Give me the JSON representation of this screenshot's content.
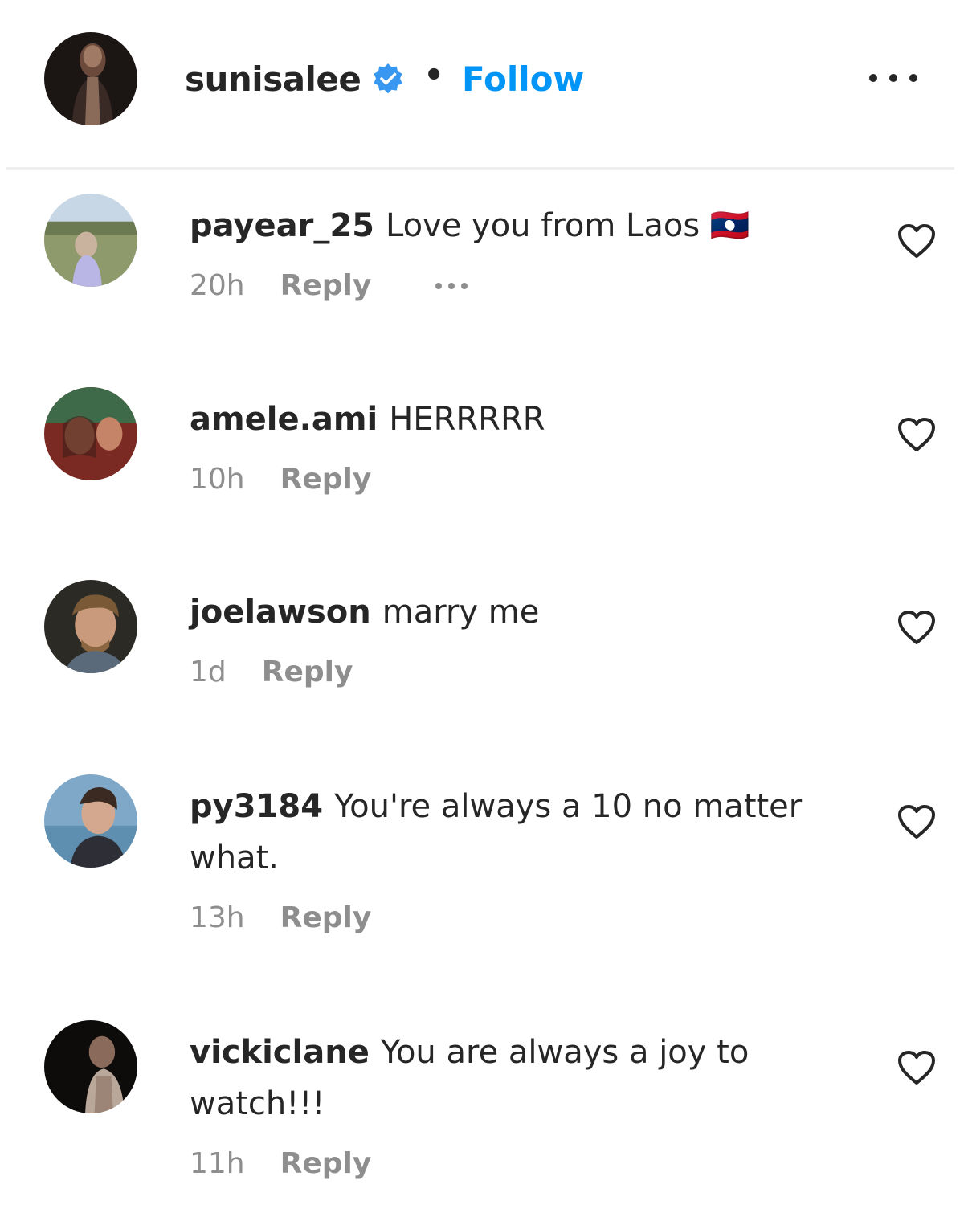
{
  "header": {
    "username": "sunisalee",
    "verified_icon": "verified-badge-icon",
    "separator": "•",
    "follow_label": "Follow",
    "more_icon": "more-options-icon"
  },
  "comments": [
    {
      "username": "payear_25",
      "text": "Love you from Laos 🇱🇦",
      "time": "20h",
      "reply_label": "Reply",
      "has_more": true
    },
    {
      "username": "amele.ami",
      "text": "HERRRRR",
      "time": "10h",
      "reply_label": "Reply",
      "has_more": false
    },
    {
      "username": "joelawson",
      "text": "marry me",
      "time": "1d",
      "reply_label": "Reply",
      "has_more": false
    },
    {
      "username": "py3184",
      "text": "You're always a 10 no matter what.",
      "time": "13h",
      "reply_label": "Reply",
      "has_more": false
    },
    {
      "username": "vickiclane",
      "text": "You are always a joy to watch!!!",
      "time": "11h",
      "reply_label": "Reply",
      "has_more": false
    }
  ],
  "colors": {
    "accent": "#0095f6",
    "text": "#262626",
    "muted": "#8e8e8e",
    "divider": "#efefef"
  }
}
